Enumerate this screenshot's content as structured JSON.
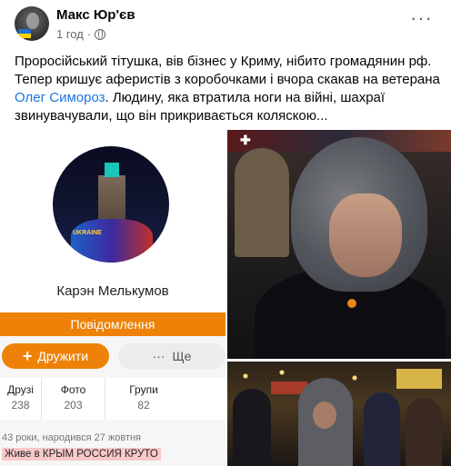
{
  "post": {
    "author": "Макс Юр'єв",
    "time": "1 год",
    "text_before_mention": "Проросійський тітушка, вів бізнес у Криму, нібито громадянин рф. Тепер кришує аферистів з коробочками і вчора скакав на ветерана ",
    "mention": "Олег Симороз",
    "text_after_mention": ". Людину, яка втратила ноги на війні, шахраї звинувачували, що він прикривається коляскою...",
    "icons": [
      "globe-icon",
      "more-options-icon"
    ]
  },
  "profile": {
    "photo_banner": "UKRAINE",
    "name": "Карэн Мелькумов",
    "message_button": "Повідомлення",
    "friends_button": "Дружити",
    "friends_icon": "+",
    "more_button": "Ще",
    "more_icon": "···",
    "stats": [
      {
        "label": "Друзі",
        "value": "238"
      },
      {
        "label": "Фото",
        "value": "203"
      },
      {
        "label": "Групи",
        "value": "82"
      }
    ],
    "bio": "43 роки, народився 27 жовтня",
    "status": "Живе в КРЫМ РОССИЯ КРУТО"
  },
  "colors": {
    "accent_orange": "#ee8208",
    "link_blue": "#1b74e4",
    "status_highlight": "#f9c9c9"
  }
}
